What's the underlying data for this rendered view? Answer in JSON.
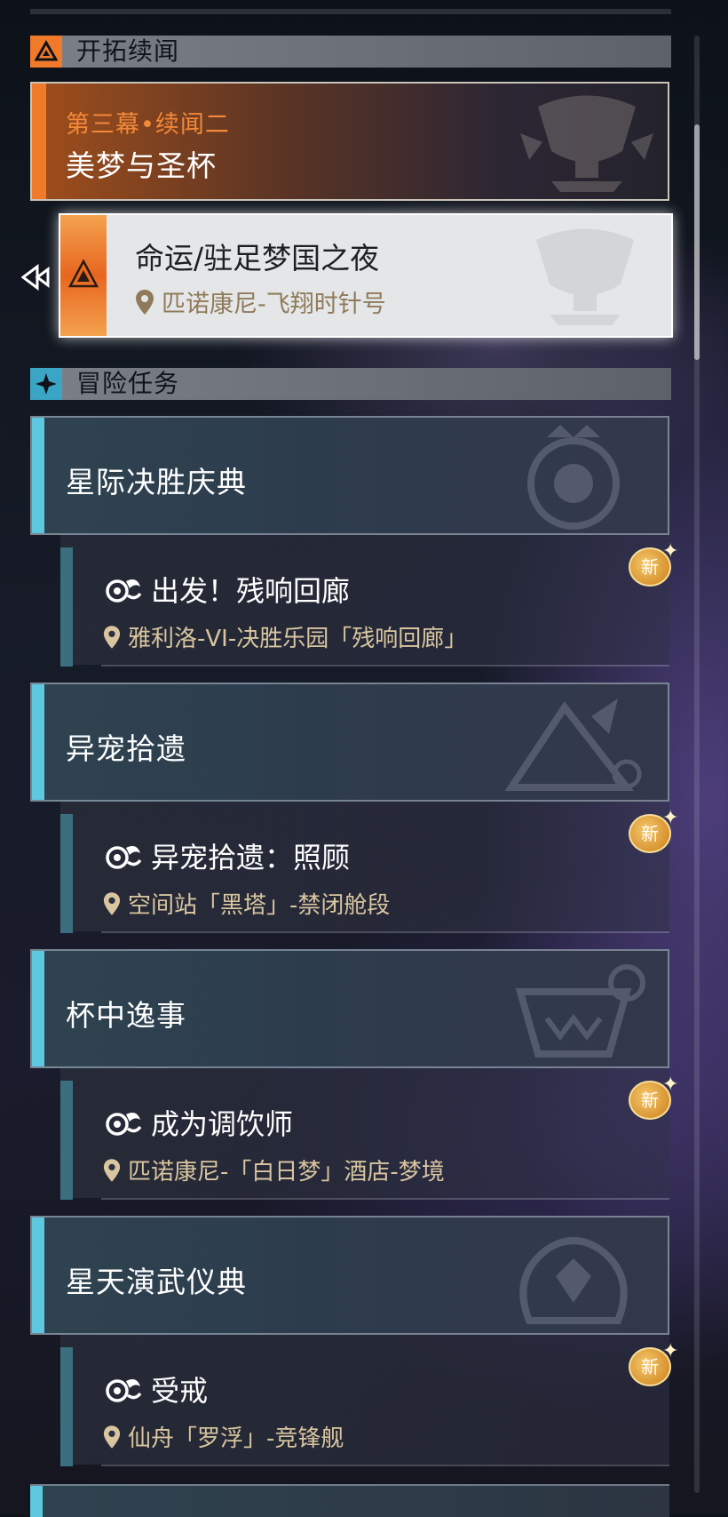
{
  "trailblaze_section": {
    "title": "开拓续闻",
    "card": {
      "subtitle": "第三幕•续闻二",
      "title": "美梦与圣杯"
    },
    "active_quest": {
      "title": "命运/驻足梦国之夜",
      "location": "匹诺康尼-飞翔时针号"
    }
  },
  "adventure_section": {
    "title": "冒险任务",
    "quests": [
      {
        "name": "星际决胜庆典",
        "sub": {
          "title": "出发！残响回廊",
          "location": "雅利洛-VI-决胜乐园「残响回廊」",
          "badge": "新"
        }
      },
      {
        "name": "异宠拾遗",
        "sub": {
          "title": "异宠拾遗：照顾",
          "location": "空间站「黑塔」-禁闭舱段",
          "badge": "新"
        }
      },
      {
        "name": "杯中逸事",
        "sub": {
          "title": "成为调饮师",
          "location": "匹诺康尼-「白日梦」酒店-梦境",
          "badge": "新"
        }
      },
      {
        "name": "星天演武仪典",
        "sub": {
          "title": "受戒",
          "location": "仙舟「罗浮」-竞锋舰",
          "badge": "新"
        }
      }
    ]
  },
  "colors": {
    "accent_orange": "#f07a2a",
    "accent_cyan": "#5ec8e0",
    "location_gold": "#d9c6a0"
  }
}
